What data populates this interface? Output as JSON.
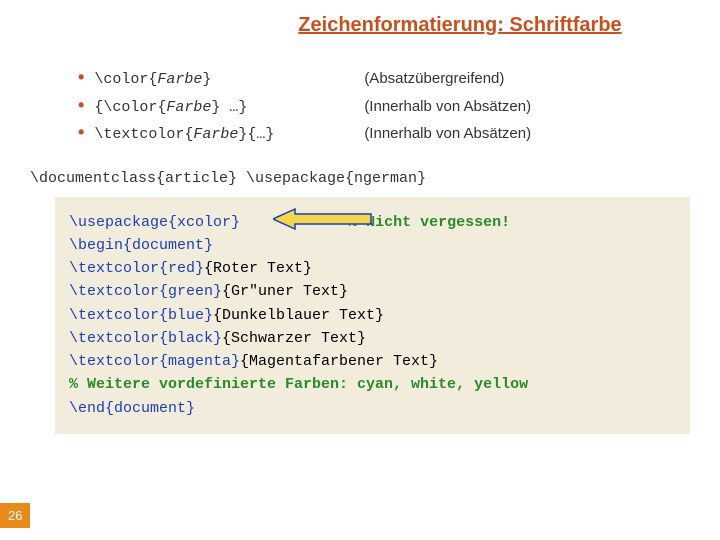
{
  "title": "Zeichenformatierung: Schriftfarbe",
  "bullets": [
    {
      "cmd_prefix": "\\color{",
      "cmd_param": "Farbe",
      "cmd_suffix": "}",
      "desc": "(Absatzübergreifend)"
    },
    {
      "cmd_prefix": "{\\color{",
      "cmd_param": "Farbe",
      "cmd_suffix": "} …}",
      "desc": "(Innerhalb von Absätzen)"
    },
    {
      "cmd_prefix": "\\textcolor{",
      "cmd_param": "Farbe",
      "cmd_suffix": "}{…}",
      "desc": "(Innerhalb von Absätzen)"
    }
  ],
  "code_header": "\\documentclass{article} \\usepackage{ngerman}",
  "code": {
    "l1a": "\\usepackage{xcolor}",
    "l1b": "% Nicht vergessen!",
    "l2": "\\begin{document}",
    "l3a": "\\textcolor{red}",
    "l3b": "{Roter Text}",
    "l4a": "\\textcolor{green}",
    "l4b": "{Gr\"uner Text}",
    "l5a": "\\textcolor{blue}",
    "l5b": "{Dunkelblauer Text}",
    "l6a": "\\textcolor{black}",
    "l6b": "{Schwarzer Text}",
    "l7a": "\\textcolor{magenta}",
    "l7b": "{Magentafarbener Text}",
    "l8": "% Weitere vordefinierte Farben: cyan, white, yellow",
    "l9": "\\end{document}"
  },
  "page_number": "26",
  "colors": {
    "accent": "#c8501e",
    "code_bg": "#f2ecdc",
    "blue": "#1a3fb5",
    "green": "#2a8a2a",
    "arrow_fill": "#f5d54a",
    "arrow_stroke": "#1a3fb5",
    "pagenum_bg": "#e88b1a"
  }
}
